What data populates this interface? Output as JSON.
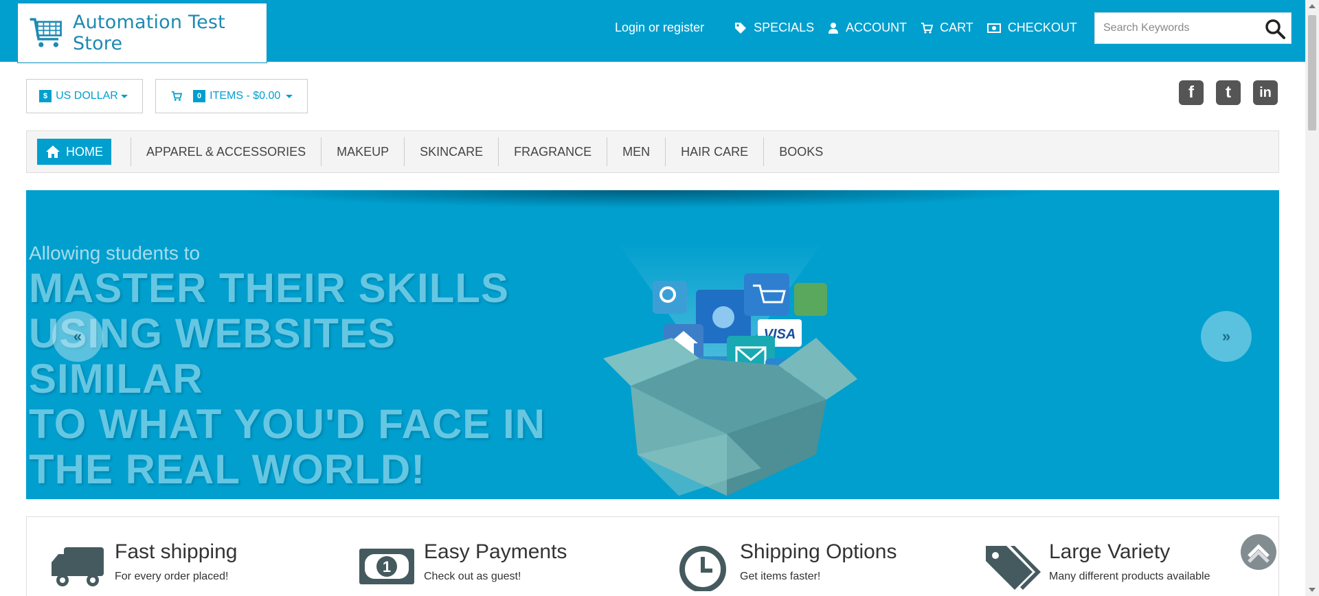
{
  "header": {
    "logo_text": "Automation Test Store",
    "login_label": "Login or register",
    "nav": [
      {
        "label": "SPECIALS",
        "icon": "tag-icon"
      },
      {
        "label": "ACCOUNT",
        "icon": "user-icon"
      },
      {
        "label": "CART",
        "icon": "cart-icon"
      },
      {
        "label": "CHECKOUT",
        "icon": "money-icon"
      }
    ],
    "search_placeholder": "Search Keywords"
  },
  "toolbar": {
    "currency_symbol": "$",
    "currency_label": "US DOLLAR",
    "cart_count": "0",
    "cart_label": "ITEMS - $0.00"
  },
  "social": [
    "f",
    "t",
    "in"
  ],
  "menu": {
    "home": "HOME",
    "items": [
      "APPAREL & ACCESSORIES",
      "MAKEUP",
      "SKINCARE",
      "FRAGRANCE",
      "MEN",
      "HAIR CARE",
      "BOOKS"
    ]
  },
  "banner": {
    "subtitle": "Allowing students to",
    "headline_lines": [
      "MASTER THEIR SKILLS",
      "USING WEBSITES SIMILAR",
      "TO WHAT YOU'D FACE IN",
      "THE REAL WORLD!"
    ],
    "arrow_left": "«",
    "arrow_right": "»",
    "box_labels": {
      "card": "VISA",
      "dollar": "$"
    }
  },
  "features": [
    {
      "title": "Fast shipping",
      "desc": "For every order placed!",
      "icon": "truck-icon"
    },
    {
      "title": "Easy Payments",
      "desc": "Check out as guest!",
      "icon": "banknote-icon"
    },
    {
      "title": "Shipping Options",
      "desc": "Get items faster!",
      "icon": "clock-icon"
    },
    {
      "title": "Large Variety",
      "desc": "Many different products available",
      "icon": "tags-icon"
    }
  ],
  "colors": {
    "brand": "#009fce",
    "banner_text": "#66c7e3"
  }
}
